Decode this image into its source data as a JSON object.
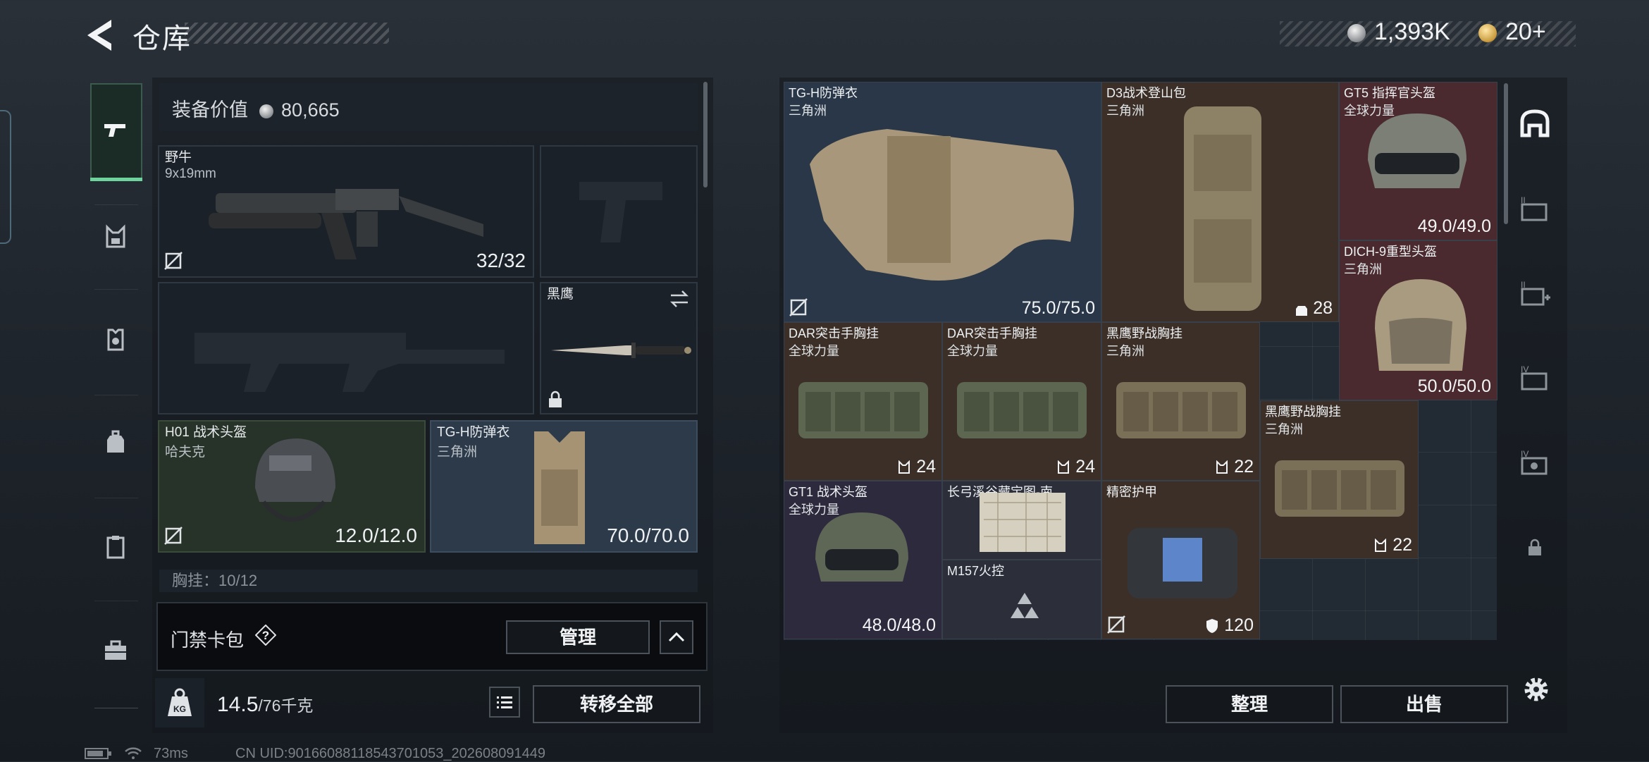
{
  "header": {
    "title": "仓库",
    "silver_amount": "1,393K",
    "gold_amount": "20+",
    "gold_add": "+"
  },
  "left_nav": {
    "icons": [
      "pistol-icon",
      "chest-rig-icon",
      "armor-icon",
      "backpack-icon",
      "clipboard-icon",
      "toolbox-icon"
    ]
  },
  "loadout": {
    "value_label": "装备价值",
    "value": "80,665",
    "primary": {
      "name": "野牛",
      "sub": "9x19mm",
      "ammo": "32/32"
    },
    "melee": {
      "name": "黑鹰"
    },
    "helmet": {
      "name": "H01 战术头盔",
      "sub": "哈夫克",
      "durability": "12.0/12.0"
    },
    "armor": {
      "name": "TG-H防弹衣",
      "sub": "三角洲",
      "durability": "70.0/70.0"
    },
    "chest_hint": "胸挂：10/12",
    "keycard": {
      "label": "门禁卡包",
      "help": "?",
      "manage": "管理"
    },
    "weight": {
      "current": "14.5",
      "max": "/76千克"
    },
    "transfer_all": "转移全部"
  },
  "storage": {
    "items": [
      {
        "name": "TG-H防弹衣",
        "sub": "三角洲",
        "value": "75.0/75.0"
      },
      {
        "name": "D3战术登山包",
        "sub": "三角洲",
        "value": "28"
      },
      {
        "name": "GT5 指挥官头盔",
        "sub": "全球力量",
        "value": "49.0/49.0"
      },
      {
        "name": "DICH-9重型头盔",
        "sub": "三角洲",
        "value": "50.0/50.0"
      },
      {
        "name": "DAR突击手胸挂",
        "sub": "全球力量",
        "value": "24"
      },
      {
        "name": "DAR突击手胸挂",
        "sub": "全球力量",
        "value": "24"
      },
      {
        "name": "黑鹰野战胸挂",
        "sub": "三角洲",
        "value": "22"
      },
      {
        "name": "黑鹰野战胸挂",
        "sub": "三角洲",
        "value": "22"
      },
      {
        "name": "GT1 战术头盔",
        "sub": "全球力量",
        "value": "48.0/48.0"
      },
      {
        "name": "长弓溪谷藏宝图-南",
        "sub": "",
        "value": ""
      },
      {
        "name": "M157火控",
        "sub": "",
        "value": ""
      },
      {
        "name": "精密护甲",
        "sub": "",
        "value": "120"
      }
    ],
    "sort": "整理",
    "sell": "出售"
  },
  "status_bar": {
    "ping": "73ms",
    "uid": "CN UID:9016608811854370105​3_202608091449"
  }
}
